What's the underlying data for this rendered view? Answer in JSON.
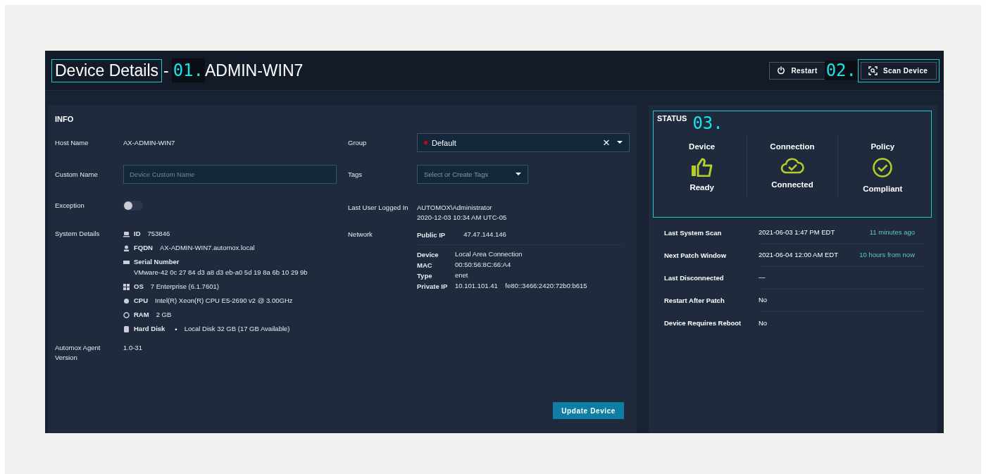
{
  "header": {
    "title": "Device Details",
    "highlighted": true,
    "separator": "-",
    "annotation": "01.",
    "device_name": "ADMIN-WIN7"
  },
  "actions": [
    {
      "kind": "power",
      "label": "Restart",
      "highlighted": false,
      "annotation": "02."
    },
    {
      "kind": "scan",
      "label": "Scan Device",
      "highlighted": true
    }
  ],
  "info": {
    "title": "INFO",
    "host_name": {
      "label": "Host Name",
      "value": "AX-ADMIN-WIN7"
    },
    "custom_name": {
      "label": "Custom Name",
      "placeholder": "Device Custom Name"
    },
    "exception": {
      "label": "Exception",
      "on": false
    },
    "system_details": {
      "label": "System Details",
      "items": [
        {
          "kind": "id",
          "label": "ID",
          "value": "753846"
        },
        {
          "kind": "fqdn",
          "label": "FQDN",
          "value": "AX-ADMIN-WIN7.automox.local"
        },
        {
          "kind": "serial",
          "label": "Serial Number",
          "value": "VMware-42 0c 27 84 d3 a8 d3 eb-a0 5d 19 8a 6b 10 29 9b"
        },
        {
          "kind": "os",
          "label": "OS",
          "value": "7 Enterprise (6.1.7601)"
        },
        {
          "kind": "cpu",
          "label": "CPU",
          "value": "Intel(R) Xeon(R) CPU E5-2690 v2 @ 3.00GHz"
        },
        {
          "kind": "ram",
          "label": "RAM",
          "value": "2 GB"
        },
        {
          "kind": "disk",
          "label": "Hard Disk",
          "bullet": "•",
          "value": "Local Disk 32 GB (17 GB Available)"
        }
      ]
    },
    "agent": {
      "label": "Automox Agent Version",
      "value": "1.0-31"
    },
    "group": {
      "label": "Group",
      "value": "Default",
      "color": "#d0021b",
      "clear": "×"
    },
    "tags": {
      "label": "Tags",
      "placeholder": "Select or Create Tags"
    },
    "last_user": {
      "label": "Last User Logged In",
      "lines": [
        "AUTOMOX\\Administrator",
        "2020-12-03 10:34 AM UTC-05"
      ]
    },
    "network": {
      "label": "Network",
      "public_ip": {
        "label": "Public IP",
        "value": "47.47.144.146"
      },
      "adapter": [
        {
          "label": "Device",
          "value": "Local Area Connection"
        },
        {
          "label": "MAC",
          "value": "00:50:56:8C:66:A4"
        },
        {
          "label": "Type",
          "value": "enet"
        },
        {
          "label": "Private IP",
          "value": "10.101.101.41    fe80::3466:2420:72b0:b615"
        }
      ]
    },
    "update_button": "Update Device"
  },
  "status": {
    "title": "STATUS",
    "annotation": "03.",
    "highlighted": true,
    "cards": [
      {
        "kind": "thumbs-up",
        "label": "Device",
        "state": "Ready"
      },
      {
        "kind": "cloud-check",
        "label": "Connection",
        "state": "Connected"
      },
      {
        "kind": "circle-check",
        "label": "Policy",
        "state": "Compliant"
      }
    ],
    "rows": [
      {
        "label": "Last System Scan",
        "value": "2021-06-03 1:47 PM EDT",
        "relative": "11 minutes ago"
      },
      {
        "label": "Next Patch Window",
        "value": "2021-06-04 12:00 AM EDT",
        "relative": "10 hours from now"
      },
      {
        "label": "Last Disconnected",
        "value": "—"
      },
      {
        "label": "Restart After Patch",
        "value": "No"
      },
      {
        "label": "Device Requires Reboot",
        "value": "No"
      }
    ]
  }
}
